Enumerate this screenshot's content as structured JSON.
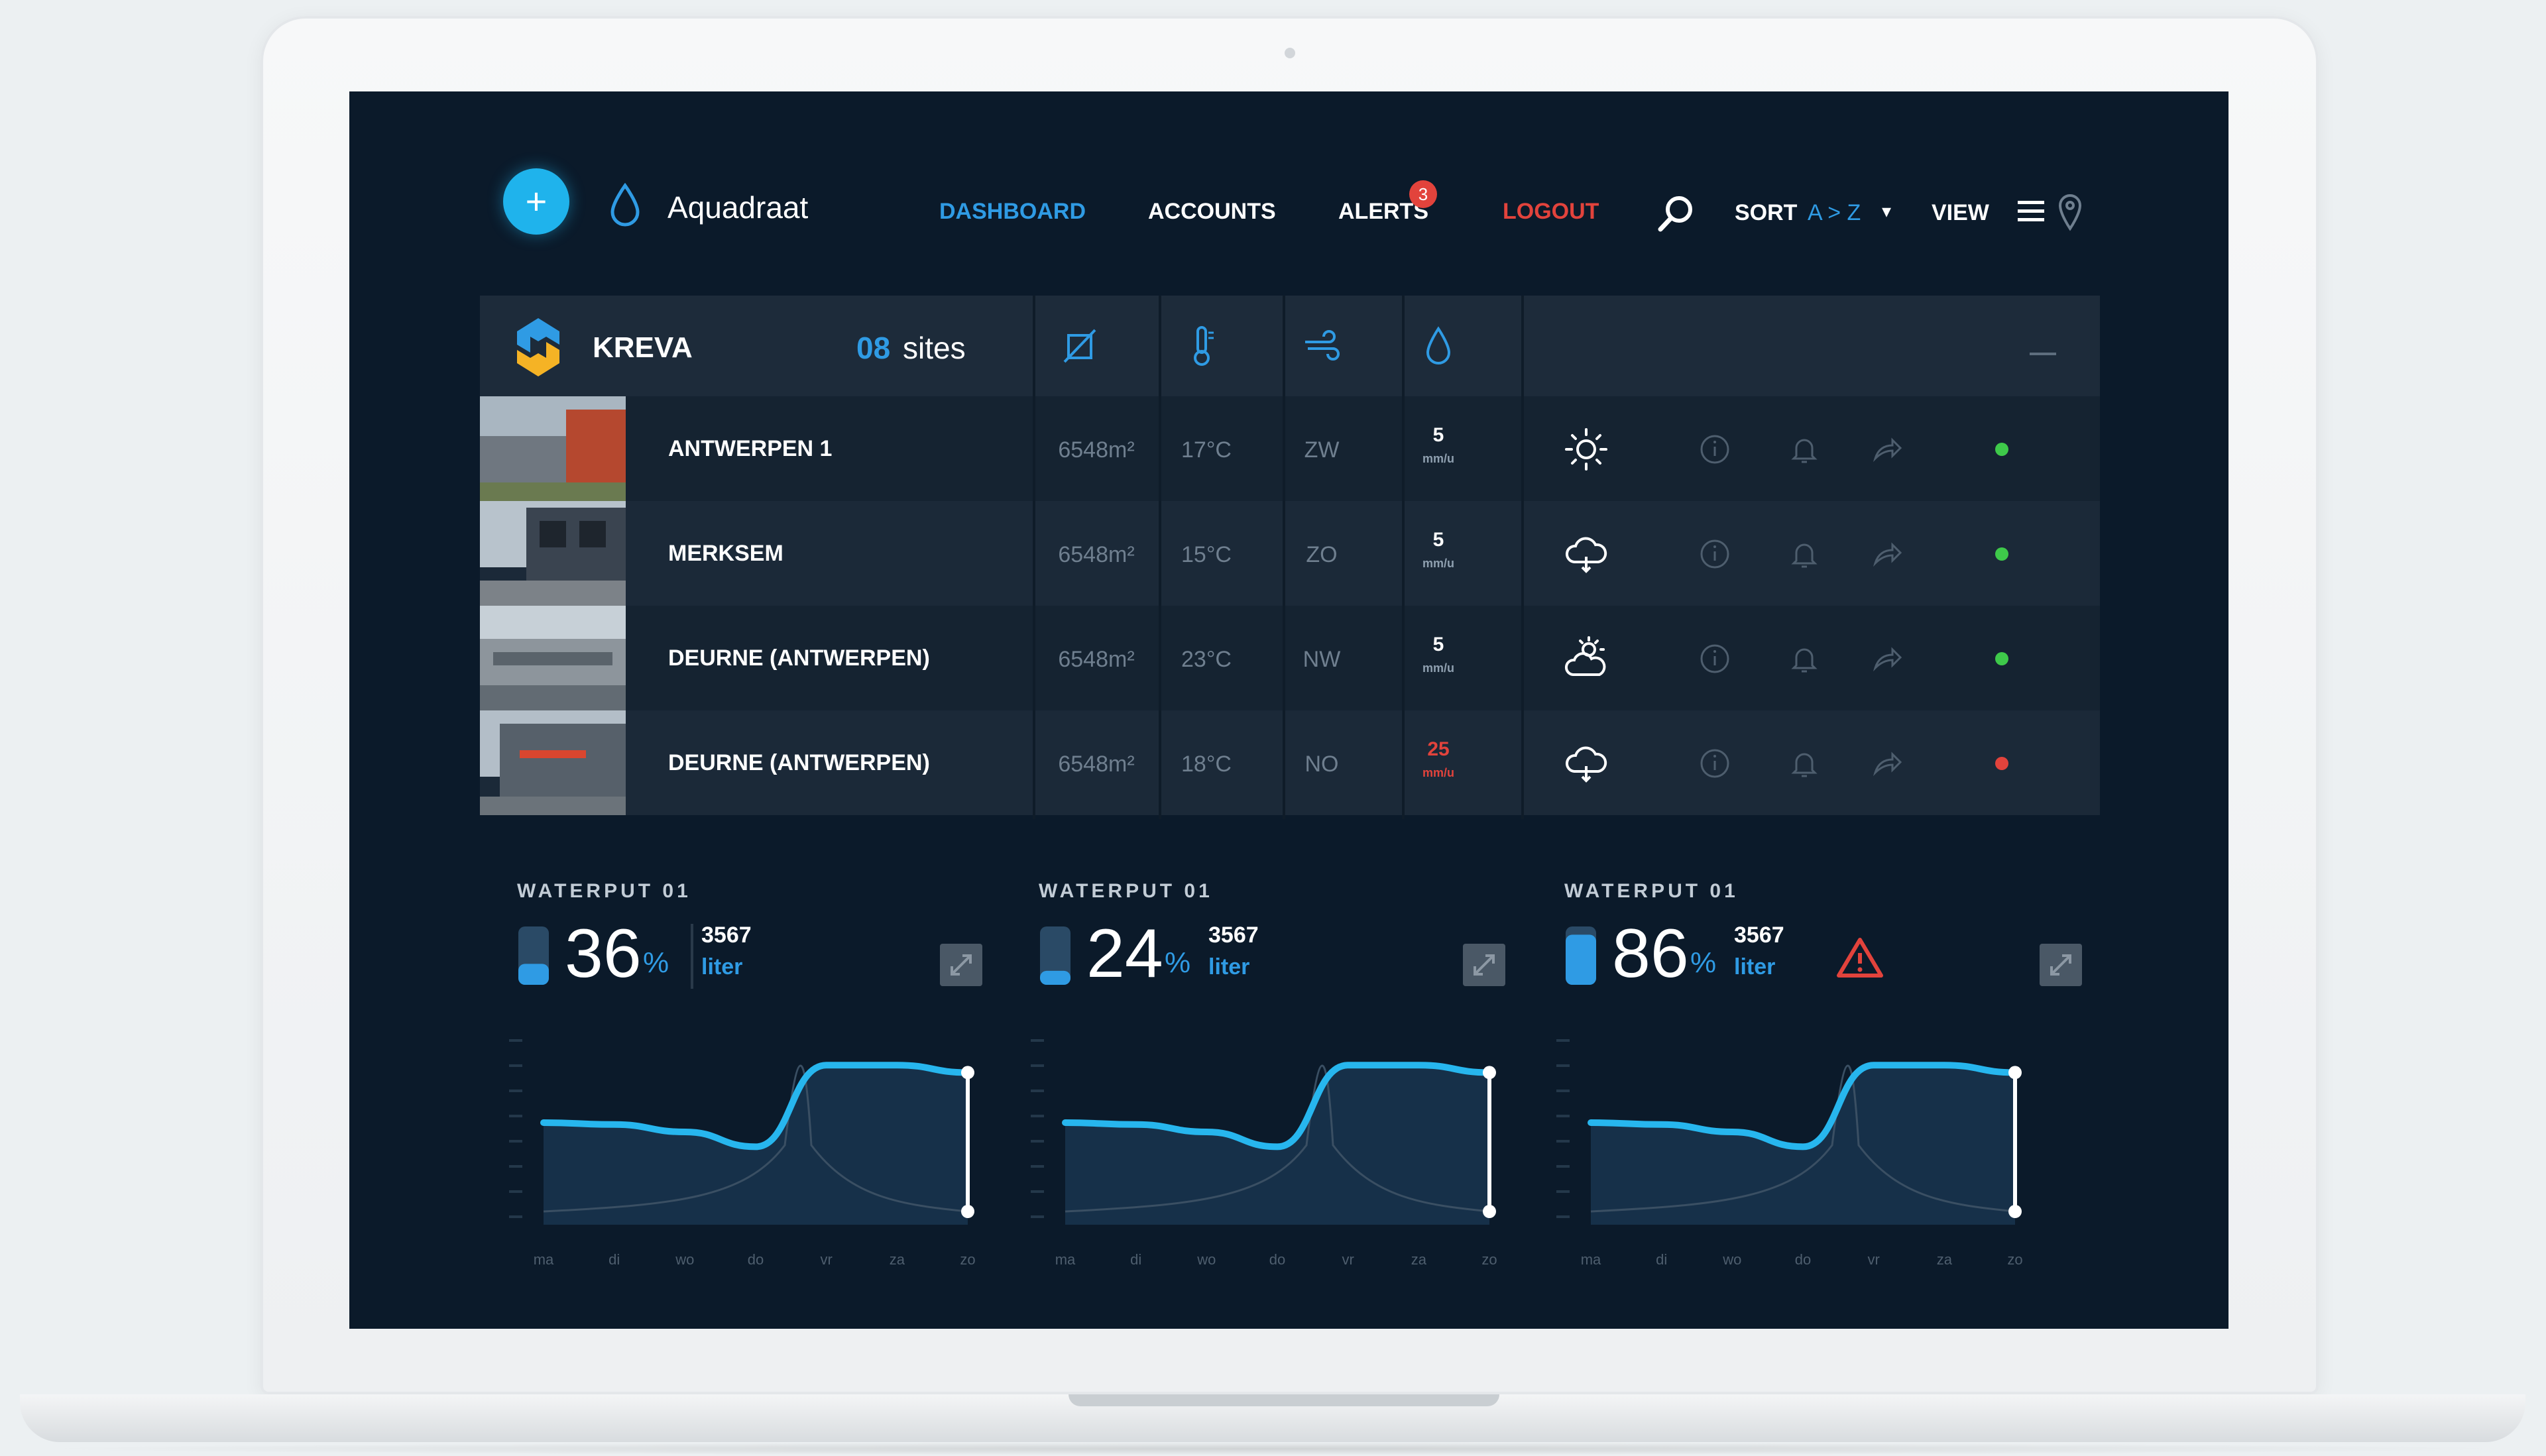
{
  "nav": {
    "add_symbol": "+",
    "brand": "Aquadraat",
    "links": {
      "dashboard": "DASHBOARD",
      "accounts": "ACCOUNTS",
      "alerts": "ALERTS",
      "alerts_count": "3",
      "logout": "LOGOUT"
    },
    "sort_label": "SORT",
    "sort_value": "A > Z",
    "sort_caret": "▾",
    "view_label": "VIEW",
    "icons": [
      "search-icon",
      "menu-icon",
      "map-pin-icon"
    ]
  },
  "table": {
    "company": "KREVA",
    "sites_count": "08",
    "sites_label": "sites",
    "column_icons": [
      "area-icon",
      "thermometer-icon",
      "wind-icon",
      "water-drop-icon"
    ],
    "rows": [
      {
        "name": "ANTWERPEN 1",
        "area": "6548m²",
        "temp": "17°C",
        "wind": "ZW",
        "rain": "5",
        "rain_unit": "mm/u",
        "weather": "sun-icon",
        "status": "ok"
      },
      {
        "name": "MERKSEM",
        "area": "6548m²",
        "temp": "15°C",
        "wind": "ZO",
        "rain": "5",
        "rain_unit": "mm/u",
        "weather": "cloud-rain-icon",
        "status": "ok"
      },
      {
        "name": "DEURNE (ANTWERPEN)",
        "area": "6548m²",
        "temp": "23°C",
        "wind": "NW",
        "rain": "5",
        "rain_unit": "mm/u",
        "weather": "sun-cloud-icon",
        "status": "ok"
      },
      {
        "name": "DEURNE (ANTWERPEN)",
        "area": "6548m²",
        "temp": "18°C",
        "wind": "NO",
        "rain": "25",
        "rain_unit": "mm/u",
        "weather": "cloud-rain-icon",
        "status": "alert"
      }
    ],
    "row_actions": [
      "info-icon",
      "bell-icon",
      "share-icon"
    ]
  },
  "colors": {
    "accent": "#2f9be4",
    "add_button": "#1fb3ec",
    "danger": "#e2433c",
    "ok": "#3ec94a",
    "screen_bg": "#0b1a2a"
  },
  "widgets": [
    {
      "title": "WATERPUT 01",
      "percent": "36",
      "percent_sign": "%",
      "level": 0.36,
      "liters": "3567",
      "liter_unit": "liter",
      "warning": false
    },
    {
      "title": "WATERPUT 01",
      "percent": "24",
      "percent_sign": "%",
      "level": 0.24,
      "liters": "3567",
      "liter_unit": "liter",
      "warning": false
    },
    {
      "title": "WATERPUT 01",
      "percent": "86",
      "percent_sign": "%",
      "level": 0.86,
      "liters": "3567",
      "liter_unit": "liter",
      "warning": true
    }
  ],
  "chart_data": [
    {
      "type": "line",
      "x": [
        "ma",
        "di",
        "wo",
        "do",
        "vr",
        "za",
        "zo"
      ],
      "level_series": [
        0.55,
        0.54,
        0.5,
        0.42,
        0.86,
        0.86,
        0.82
      ]
    },
    {
      "type": "line",
      "x": [
        "ma",
        "di",
        "wo",
        "do",
        "vr",
        "za",
        "zo"
      ],
      "level_series": [
        0.55,
        0.54,
        0.5,
        0.42,
        0.86,
        0.86,
        0.82
      ]
    },
    {
      "type": "line",
      "x": [
        "ma",
        "di",
        "wo",
        "do",
        "vr",
        "za",
        "zo"
      ],
      "level_series": [
        0.55,
        0.54,
        0.5,
        0.42,
        0.86,
        0.86,
        0.82
      ]
    }
  ]
}
